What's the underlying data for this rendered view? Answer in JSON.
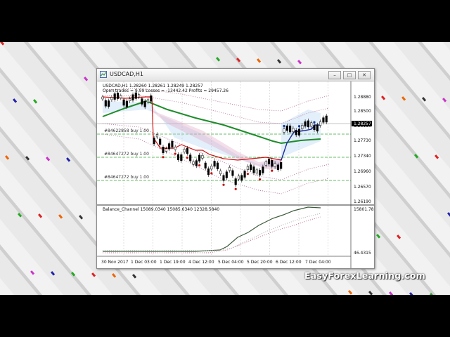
{
  "window": {
    "title": "USDCAD,H1"
  },
  "chart": {
    "header": "USDCAD,H1  1.28260 1.28261 1.28249 1.28257",
    "stats": "Open trades = 9.99   Losses = -13442.42   Profits = 29457.26",
    "order_labels": [
      "#84622858 buy 1.00",
      "#84647272 buy 1.00",
      "#84647272 buy 1.00"
    ],
    "price_ticks": [
      "1.28880",
      "1.28500",
      "1.28110",
      "1.27730",
      "1.27340",
      "1.26960",
      "1.26570",
      "1.26190"
    ],
    "current_price": "1.28257",
    "indicator_title": "Balance_Channel 15089.0340 15085.6340 12328.5840",
    "indicator_ticks": [
      "15801.78",
      "46.4315"
    ],
    "time_ticks": [
      "30 Nov 2017",
      "1 Dec 03:00",
      "1 Dec 19:00",
      "4 Dec 12:00",
      "5 Dec 04:00",
      "5 Dec 20:00",
      "6 Dec 12:00",
      "7 Dec 04:00"
    ]
  },
  "watermark": "EasyForexLearning.com",
  "colors": {
    "green_ma": "#1e8c2a",
    "red_line": "#d01010",
    "blue_line": "#1a2a9a",
    "balance": "#3b5a3b"
  }
}
